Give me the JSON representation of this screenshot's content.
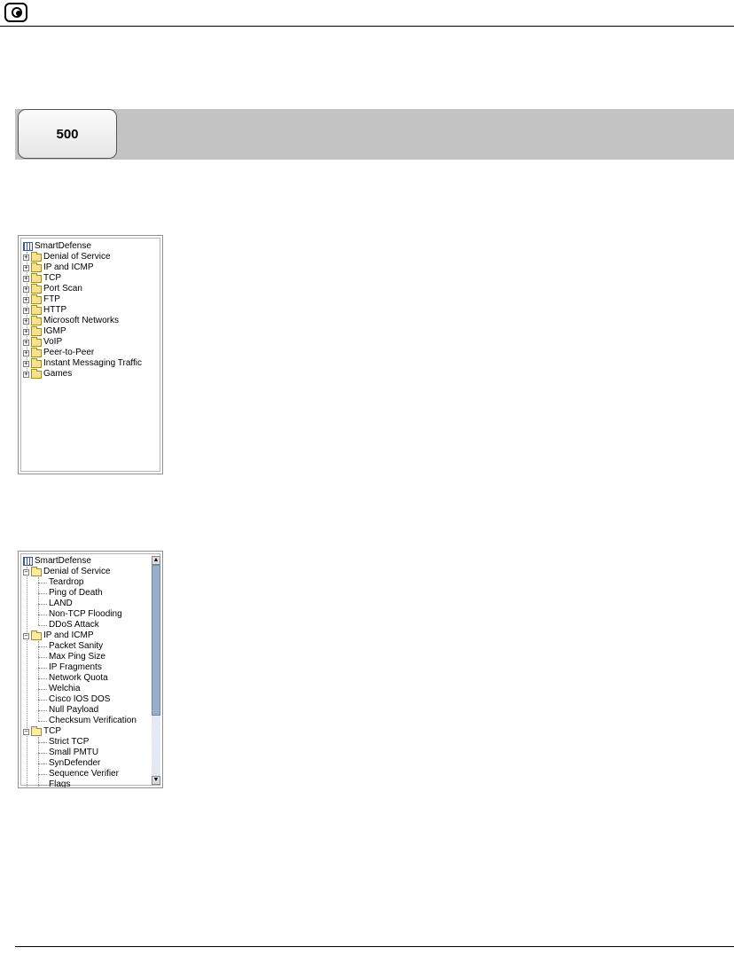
{
  "header": {
    "logo_icon": "circle-logo-icon"
  },
  "chapter": {
    "number": "500",
    "band_color": "#c3c3c3"
  },
  "tree_collapsed": {
    "root": "SmartDefense",
    "items": [
      "Denial of Service",
      "IP and ICMP",
      "TCP",
      "Port Scan",
      "FTP",
      "HTTP",
      "Microsoft Networks",
      "IGMP",
      "VoIP",
      "Peer-to-Peer",
      "Instant Messaging Traffic",
      "Games"
    ]
  },
  "tree_expanded": {
    "root": "SmartDefense",
    "groups": [
      {
        "label": "Denial of Service",
        "children": [
          "Teardrop",
          "Ping of Death",
          "LAND",
          "Non-TCP Flooding",
          "DDoS Attack"
        ]
      },
      {
        "label": "IP and ICMP",
        "children": [
          "Packet Sanity",
          "Max Ping Size",
          "IP Fragments",
          "Network Quota",
          "Welchia",
          "Cisco IOS DOS",
          "Null Payload",
          "Checksum Verification"
        ]
      },
      {
        "label": "TCP",
        "children": [
          "Strict TCP",
          "Small PMTU",
          "SynDefender",
          "Sequence Verifier",
          "Flags"
        ]
      }
    ]
  },
  "icons": {
    "expand": "+",
    "collapse": "−",
    "scroll_up": "▲",
    "scroll_down": "▼"
  }
}
